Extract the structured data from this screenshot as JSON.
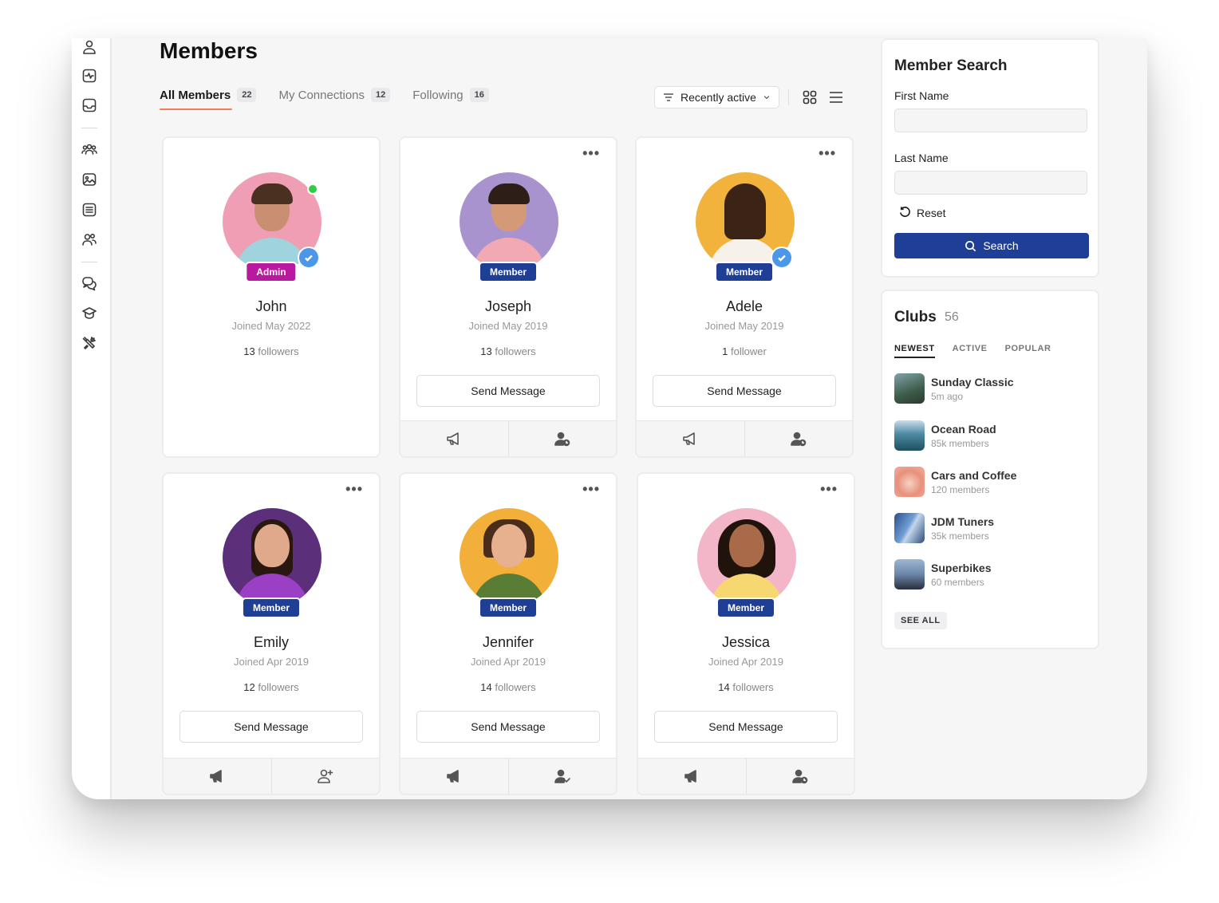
{
  "page": {
    "title": "Members"
  },
  "tabs": [
    {
      "label": "All Members",
      "count": "22"
    },
    {
      "label": "My Connections",
      "count": "12"
    },
    {
      "label": "Following",
      "count": "16"
    }
  ],
  "sort": {
    "label": "Recently active"
  },
  "members": [
    {
      "name": "John",
      "role": "Admin",
      "joined": "Joined May 2022",
      "followers_count": "13",
      "followers_word": "followers",
      "send_label": "",
      "online": true,
      "verified": true
    },
    {
      "name": "Joseph",
      "role": "Member",
      "joined": "Joined May 2019",
      "followers_count": "13",
      "followers_word": "followers",
      "send_label": "Send Message"
    },
    {
      "name": "Adele",
      "role": "Member",
      "joined": "Joined May 2019",
      "followers_count": "1",
      "followers_word": "follower",
      "send_label": "Send Message",
      "verified": true
    },
    {
      "name": "Emily",
      "role": "Member",
      "joined": "Joined Apr 2019",
      "followers_count": "12",
      "followers_word": "followers",
      "send_label": "Send Message"
    },
    {
      "name": "Jennifer",
      "role": "Member",
      "joined": "Joined Apr 2019",
      "followers_count": "14",
      "followers_word": "followers",
      "send_label": "Send Message"
    },
    {
      "name": "Jessica",
      "role": "Member",
      "joined": "Joined Apr 2019",
      "followers_count": "14",
      "followers_word": "followers",
      "send_label": "Send Message"
    }
  ],
  "search": {
    "title": "Member Search",
    "first_name_label": "First Name",
    "last_name_label": "Last Name",
    "reset_label": "Reset",
    "search_label": "Search"
  },
  "clubs": {
    "title": "Clubs",
    "count": "56",
    "tabs": [
      "NEWEST",
      "ACTIVE",
      "POPULAR"
    ],
    "items": [
      {
        "name": "Sunday Classic",
        "sub": "5m ago"
      },
      {
        "name": "Ocean Road",
        "sub": "85k members"
      },
      {
        "name": "Cars and Coffee",
        "sub": "120 members"
      },
      {
        "name": "JDM Tuners",
        "sub": "35k members"
      },
      {
        "name": "Superbikes",
        "sub": "60 members"
      }
    ],
    "see_all": "SEE ALL"
  },
  "colors": {
    "accent": "#1f3f96",
    "admin": "#b8199f",
    "tab_underline": "#f07e55"
  }
}
